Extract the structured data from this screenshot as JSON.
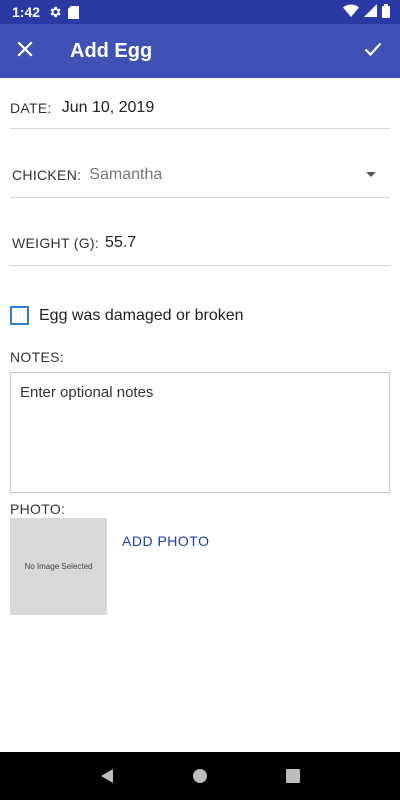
{
  "status_bar": {
    "time": "1:42",
    "icons": [
      "gear-icon",
      "sd-card-icon",
      "wifi-icon",
      "cell-signal-icon",
      "battery-icon"
    ]
  },
  "app_bar": {
    "title": "Add Egg",
    "close_icon": "close-icon",
    "confirm_icon": "check-icon",
    "background_color": "#3f51b5"
  },
  "form": {
    "date": {
      "label": "DATE:",
      "value": "Jun 10, 2019"
    },
    "chicken": {
      "label": "CHICKEN:",
      "value": "Samantha"
    },
    "weight": {
      "label": "WEIGHT (G):",
      "value": "55.7"
    },
    "damaged": {
      "label": "Egg was damaged or broken",
      "checked": false
    },
    "notes": {
      "label": "NOTES:",
      "placeholder": "Enter optional notes",
      "value": ""
    },
    "photo": {
      "label": "PHOTO:",
      "empty_text": "No Image Selected",
      "add_button": "ADD PHOTO"
    }
  },
  "nav_bar": {
    "icons": [
      "back-icon",
      "home-icon",
      "recents-icon"
    ]
  }
}
